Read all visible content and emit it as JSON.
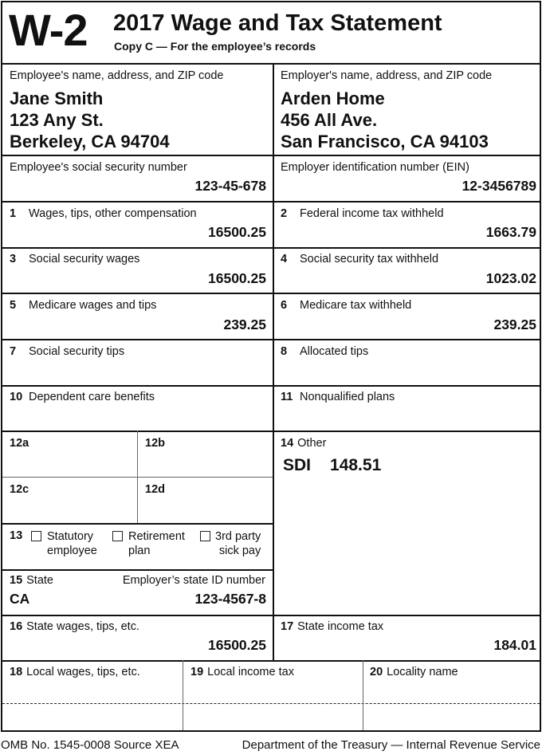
{
  "header": {
    "form_id": "W-2",
    "title": "2017 Wage and Tax Statement",
    "subtitle": "Copy C — For the employee’s records"
  },
  "employee": {
    "label": "Employee's name, address, and ZIP code",
    "name": "Jane Smith",
    "address1": "123 Any St.",
    "address2": "Berkeley, CA 94704"
  },
  "employer": {
    "label": "Employer's name, address, and ZIP code",
    "name": "Arden Home",
    "address1": "456 All Ave.",
    "address2": "San Francisco, CA 94103"
  },
  "ssn": {
    "label": "Employee's social security number",
    "value": "123-45-678"
  },
  "ein": {
    "label": "Employer identification number (EIN)",
    "value": "12-3456789"
  },
  "boxes": {
    "b1": {
      "num": "1",
      "label": "Wages, tips, other compensation",
      "value": "16500.25"
    },
    "b2": {
      "num": "2",
      "label": "Federal income tax withheld",
      "value": "1663.79"
    },
    "b3": {
      "num": "3",
      "label": "Social security wages",
      "value": "16500.25"
    },
    "b4": {
      "num": "4",
      "label": "Social security tax withheld",
      "value": "1023.02"
    },
    "b5": {
      "num": "5",
      "label": "Medicare wages and tips",
      "value": "239.25"
    },
    "b6": {
      "num": "6",
      "label": "Medicare tax withheld",
      "value": "239.25"
    },
    "b7": {
      "num": "7",
      "label": "Social security tips",
      "value": ""
    },
    "b8": {
      "num": "8",
      "label": "Allocated tips",
      "value": ""
    },
    "b10": {
      "num": "10",
      "label": "Dependent care benefits",
      "value": ""
    },
    "b11": {
      "num": "11",
      "label": "Nonqualified plans",
      "value": ""
    },
    "b12a": {
      "num": "12a"
    },
    "b12b": {
      "num": "12b"
    },
    "b12c": {
      "num": "12c"
    },
    "b12d": {
      "num": "12d"
    },
    "b13": {
      "num": "13",
      "statutory_line1": "Statutory",
      "statutory_line2": "employee",
      "statutory_checked": false,
      "retirement_line1": "Retirement",
      "retirement_line2": "plan",
      "retirement_checked": false,
      "sick_line1": "3rd party",
      "sick_line2": "sick pay",
      "sick_checked": false
    },
    "b14": {
      "num": "14",
      "label": "Other",
      "code": "SDI",
      "value": "148.51"
    },
    "b15": {
      "num": "15",
      "label": "State",
      "state": "CA",
      "id_label": "Employer’s state ID number",
      "id_value": "123-4567-8"
    },
    "b16": {
      "num": "16",
      "label": "State wages, tips, etc.",
      "value": "16500.25"
    },
    "b17": {
      "num": "17",
      "label": "State income tax",
      "value": "184.01"
    },
    "b18": {
      "num": "18",
      "label": "Local wages, tips, etc."
    },
    "b19": {
      "num": "19",
      "label": "Local income tax"
    },
    "b20": {
      "num": "20",
      "label": "Locality name"
    }
  },
  "footer": {
    "omb": "OMB No. 1545-0008  Source XEA",
    "agency": "Department of the Treasury — Internal Revenue Service"
  }
}
